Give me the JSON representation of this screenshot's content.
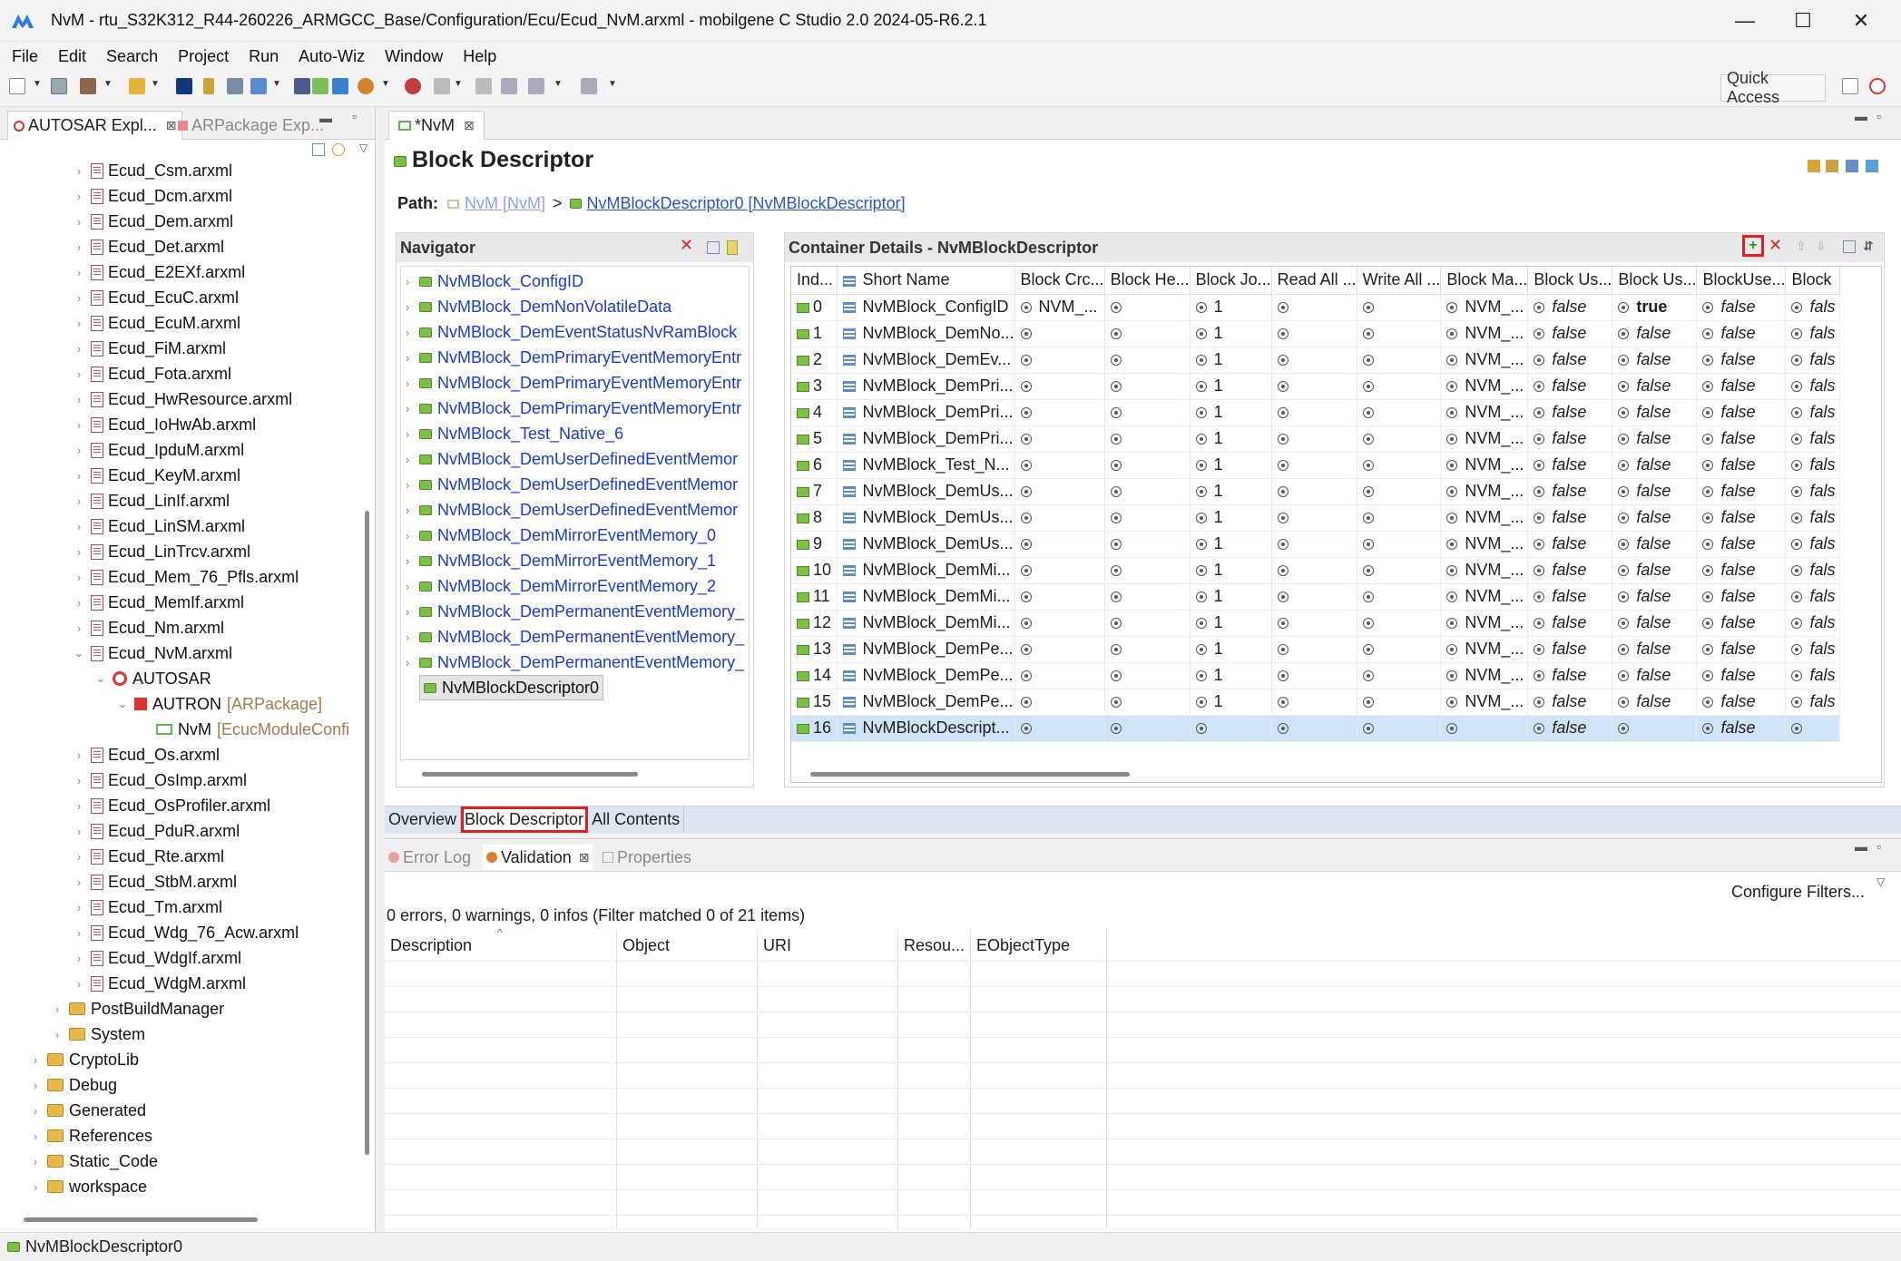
{
  "window": {
    "title": "NvM - rtu_S32K312_R44-260226_ARMGCC_Base/Configuration/Ecu/Ecud_NvM.arxml - mobilgene C Studio 2.0 2024-05-R6.2.1",
    "minimize": "—",
    "maximize": "☐",
    "close": "✕"
  },
  "menu": [
    "File",
    "Edit",
    "Search",
    "Project",
    "Run",
    "Auto-Wiz",
    "Window",
    "Help"
  ],
  "toolbar": {
    "quick_access": "Quick Access"
  },
  "left_panel": {
    "tab_autosar": "AUTOSAR Expl...",
    "tab_autosar_close": "⊠",
    "tab_arpackage": "ARPackage Exp...",
    "files": [
      "Ecud_Csm.arxml",
      "Ecud_Dcm.arxml",
      "Ecud_Dem.arxml",
      "Ecud_Det.arxml",
      "Ecud_E2EXf.arxml",
      "Ecud_EcuC.arxml",
      "Ecud_EcuM.arxml",
      "Ecud_FiM.arxml",
      "Ecud_Fota.arxml",
      "Ecud_HwResource.arxml",
      "Ecud_IoHwAb.arxml",
      "Ecud_IpduM.arxml",
      "Ecud_KeyM.arxml",
      "Ecud_LinIf.arxml",
      "Ecud_LinSM.arxml",
      "Ecud_LinTrcv.arxml",
      "Ecud_Mem_76_Pfls.arxml",
      "Ecud_MemIf.arxml",
      "Ecud_Nm.arxml",
      "Ecud_NvM.arxml"
    ],
    "nvm_children": {
      "autosar": "AUTOSAR",
      "autron": "AUTRON",
      "autron_type": "[ARPackage]",
      "nvm": "NvM",
      "nvm_type": "[EcucModuleConfi"
    },
    "files_after": [
      "Ecud_Os.arxml",
      "Ecud_OsImp.arxml",
      "Ecud_OsProfiler.arxml",
      "Ecud_PduR.arxml",
      "Ecud_Rte.arxml",
      "Ecud_StbM.arxml",
      "Ecud_Tm.arxml",
      "Ecud_Wdg_76_Acw.arxml",
      "Ecud_WdgIf.arxml",
      "Ecud_WdgM.arxml"
    ],
    "subfolders": [
      "PostBuildManager",
      "System"
    ],
    "root_folders": [
      "CryptoLib",
      "Debug",
      "Generated",
      "References",
      "Static_Code",
      "workspace"
    ]
  },
  "editor": {
    "tab_label": "*NvM",
    "tab_close": "⊠",
    "title": "Block Descriptor",
    "path_label": "Path:",
    "path_root": "NvM [NvM]",
    "path_sep": ">",
    "path_leaf": "NvMBlockDescriptor0 [NvMBlockDescriptor]",
    "navigator_title": "Navigator",
    "navigator_items": [
      "NvMBlock_ConfigID",
      "NvMBlock_DemNonVolatileData",
      "NvMBlock_DemEventStatusNvRamBlock",
      "NvMBlock_DemPrimaryEventMemoryEntr",
      "NvMBlock_DemPrimaryEventMemoryEntr",
      "NvMBlock_DemPrimaryEventMemoryEntr",
      "NvMBlock_Test_Native_6",
      "NvMBlock_DemUserDefinedEventMemor",
      "NvMBlock_DemUserDefinedEventMemor",
      "NvMBlock_DemUserDefinedEventMemor",
      "NvMBlock_DemMirrorEventMemory_0",
      "NvMBlock_DemMirrorEventMemory_1",
      "NvMBlock_DemMirrorEventMemory_2",
      "NvMBlock_DemPermanentEventMemory_",
      "NvMBlock_DemPermanentEventMemory_",
      "NvMBlock_DemPermanentEventMemory_"
    ],
    "navigator_selected": "NvMBlockDescriptor0",
    "details_title": "Container Details - NvMBlockDescriptor",
    "columns": [
      "Ind...",
      "Short Name",
      "Block Crc...",
      "Block He...",
      "Block Jo...",
      "Read All ...",
      "Write All ...",
      "Block Ma...",
      "Block Us...",
      "Block Us...",
      "BlockUse...",
      "Block"
    ],
    "rows": [
      {
        "idx": "0",
        "name": "NvMBlock_ConfigID",
        "crc": "NVM_...",
        "jo": "1",
        "ma": "NVM_...",
        "us1": "false",
        "us2": "true",
        "use": "false",
        "last": "fals"
      },
      {
        "idx": "1",
        "name": "NvMBlock_DemNo...",
        "crc": "",
        "jo": "1",
        "ma": "NVM_...",
        "us1": "false",
        "us2": "false",
        "use": "false",
        "last": "fals"
      },
      {
        "idx": "2",
        "name": "NvMBlock_DemEv...",
        "crc": "",
        "jo": "1",
        "ma": "NVM_...",
        "us1": "false",
        "us2": "false",
        "use": "false",
        "last": "fals"
      },
      {
        "idx": "3",
        "name": "NvMBlock_DemPri...",
        "crc": "",
        "jo": "1",
        "ma": "NVM_...",
        "us1": "false",
        "us2": "false",
        "use": "false",
        "last": "fals"
      },
      {
        "idx": "4",
        "name": "NvMBlock_DemPri...",
        "crc": "",
        "jo": "1",
        "ma": "NVM_...",
        "us1": "false",
        "us2": "false",
        "use": "false",
        "last": "fals"
      },
      {
        "idx": "5",
        "name": "NvMBlock_DemPri...",
        "crc": "",
        "jo": "1",
        "ma": "NVM_...",
        "us1": "false",
        "us2": "false",
        "use": "false",
        "last": "fals"
      },
      {
        "idx": "6",
        "name": "NvMBlock_Test_N...",
        "crc": "",
        "jo": "1",
        "ma": "NVM_...",
        "us1": "false",
        "us2": "false",
        "use": "false",
        "last": "fals"
      },
      {
        "idx": "7",
        "name": "NvMBlock_DemUs...",
        "crc": "",
        "jo": "1",
        "ma": "NVM_...",
        "us1": "false",
        "us2": "false",
        "use": "false",
        "last": "fals"
      },
      {
        "idx": "8",
        "name": "NvMBlock_DemUs...",
        "crc": "",
        "jo": "1",
        "ma": "NVM_...",
        "us1": "false",
        "us2": "false",
        "use": "false",
        "last": "fals"
      },
      {
        "idx": "9",
        "name": "NvMBlock_DemUs...",
        "crc": "",
        "jo": "1",
        "ma": "NVM_...",
        "us1": "false",
        "us2": "false",
        "use": "false",
        "last": "fals"
      },
      {
        "idx": "10",
        "name": "NvMBlock_DemMi...",
        "crc": "",
        "jo": "1",
        "ma": "NVM_...",
        "us1": "false",
        "us2": "false",
        "use": "false",
        "last": "fals"
      },
      {
        "idx": "11",
        "name": "NvMBlock_DemMi...",
        "crc": "",
        "jo": "1",
        "ma": "NVM_...",
        "us1": "false",
        "us2": "false",
        "use": "false",
        "last": "fals"
      },
      {
        "idx": "12",
        "name": "NvMBlock_DemMi...",
        "crc": "",
        "jo": "1",
        "ma": "NVM_...",
        "us1": "false",
        "us2": "false",
        "use": "false",
        "last": "fals"
      },
      {
        "idx": "13",
        "name": "NvMBlock_DemPe...",
        "crc": "",
        "jo": "1",
        "ma": "NVM_...",
        "us1": "false",
        "us2": "false",
        "use": "false",
        "last": "fals"
      },
      {
        "idx": "14",
        "name": "NvMBlock_DemPe...",
        "crc": "",
        "jo": "1",
        "ma": "NVM_...",
        "us1": "false",
        "us2": "false",
        "use": "false",
        "last": "fals"
      },
      {
        "idx": "15",
        "name": "NvMBlock_DemPe...",
        "crc": "",
        "jo": "1",
        "ma": "NVM_...",
        "us1": "false",
        "us2": "false",
        "use": "false",
        "last": "fals"
      },
      {
        "idx": "16",
        "name": "NvMBlockDescript...",
        "crc": "",
        "jo": "",
        "ma": "",
        "us1": "false",
        "us2": "",
        "use": "false",
        "last": ""
      }
    ],
    "page_tabs": [
      "Overview",
      "Block Descriptor",
      "All Contents"
    ],
    "active_page_tab": "Block Descriptor"
  },
  "validation": {
    "tab_error_log": "Error Log",
    "tab_validation": "Validation",
    "tab_properties": "Properties",
    "summary": "0 errors, 0 warnings, 0 infos (Filter matched 0 of 21 items)",
    "configure_filters": "Configure Filters...",
    "columns": [
      "Description",
      "Object",
      "URI",
      "Resou...",
      "EObjectType"
    ]
  },
  "statusbar": {
    "text": "NvMBlockDescriptor0"
  },
  "colors": {
    "link": "#2a55d0",
    "selection": "#cfe4f7",
    "highlight_border": "#e02020",
    "folder_green": "#7ac043"
  }
}
